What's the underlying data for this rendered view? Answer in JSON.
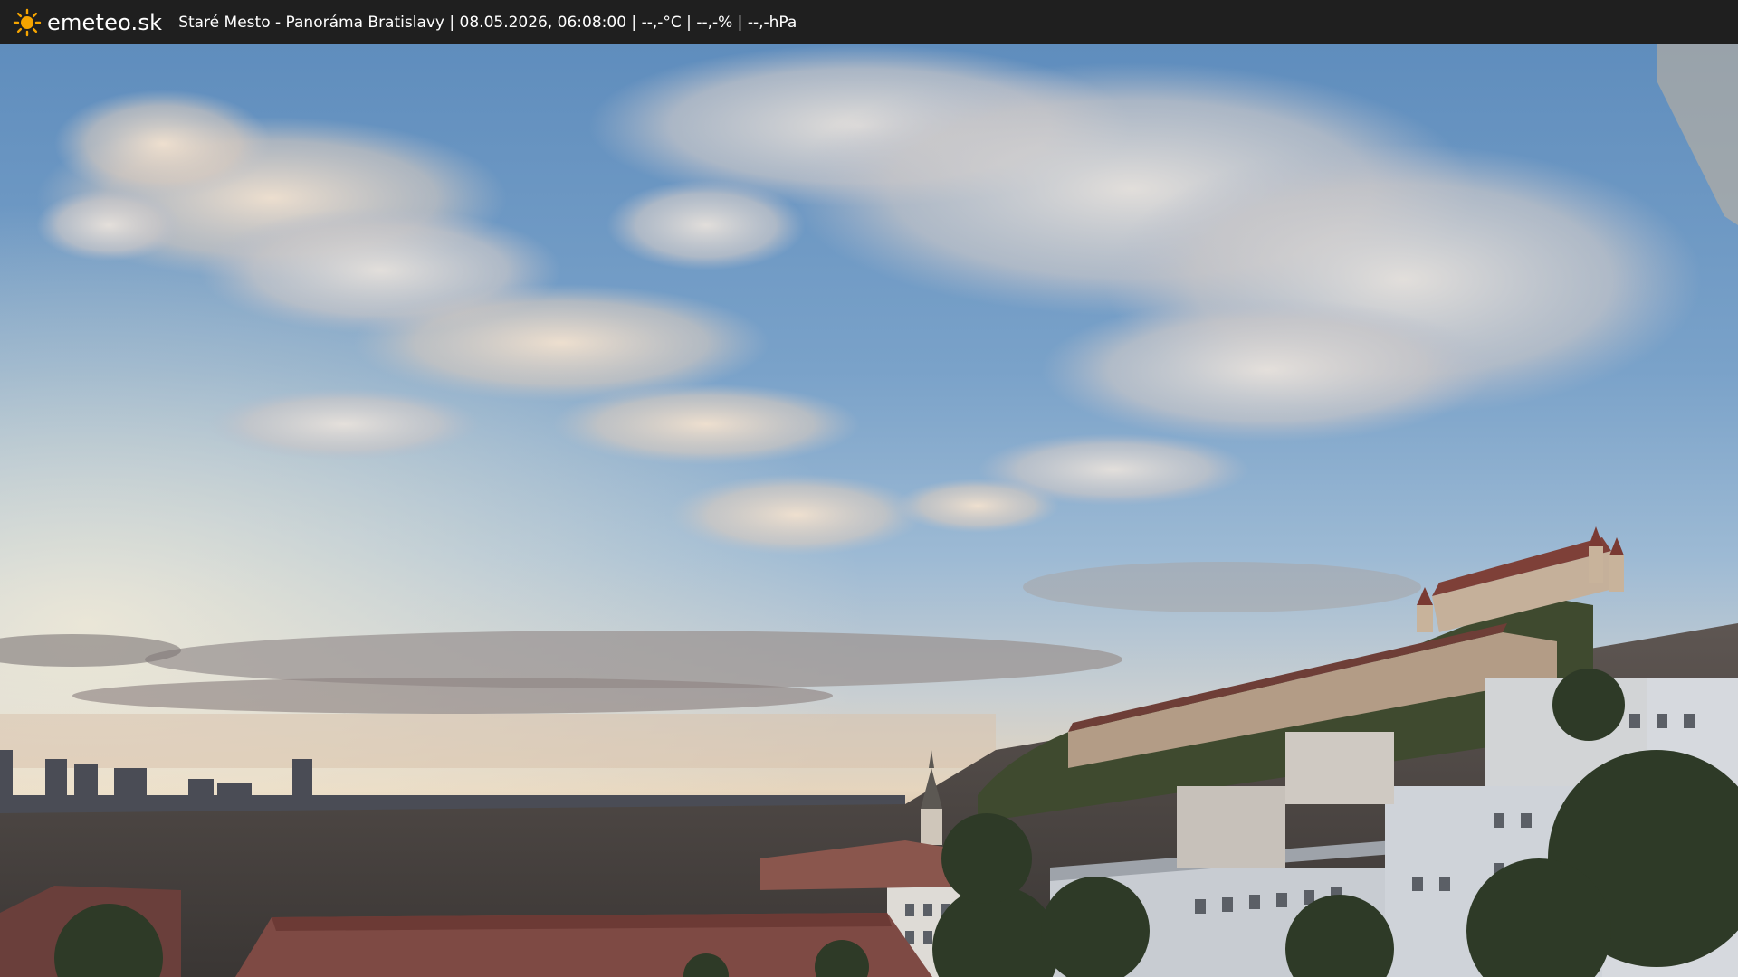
{
  "header": {
    "brand": "emeteo.sk",
    "location": "Staré Mesto - Panoráma Bratislavy",
    "datetime": "08.05.2026, 06:08:00",
    "temperature": "--,-°C",
    "humidity": "--,-%",
    "pressure": "--,-hPa"
  },
  "icons": {
    "logo": "sun-icon"
  },
  "colors": {
    "bar_background": "#1f1f1f",
    "sun": "#f5a400",
    "sky_top": "#6f9bc8",
    "sky_horizon": "#e9d6b8"
  }
}
